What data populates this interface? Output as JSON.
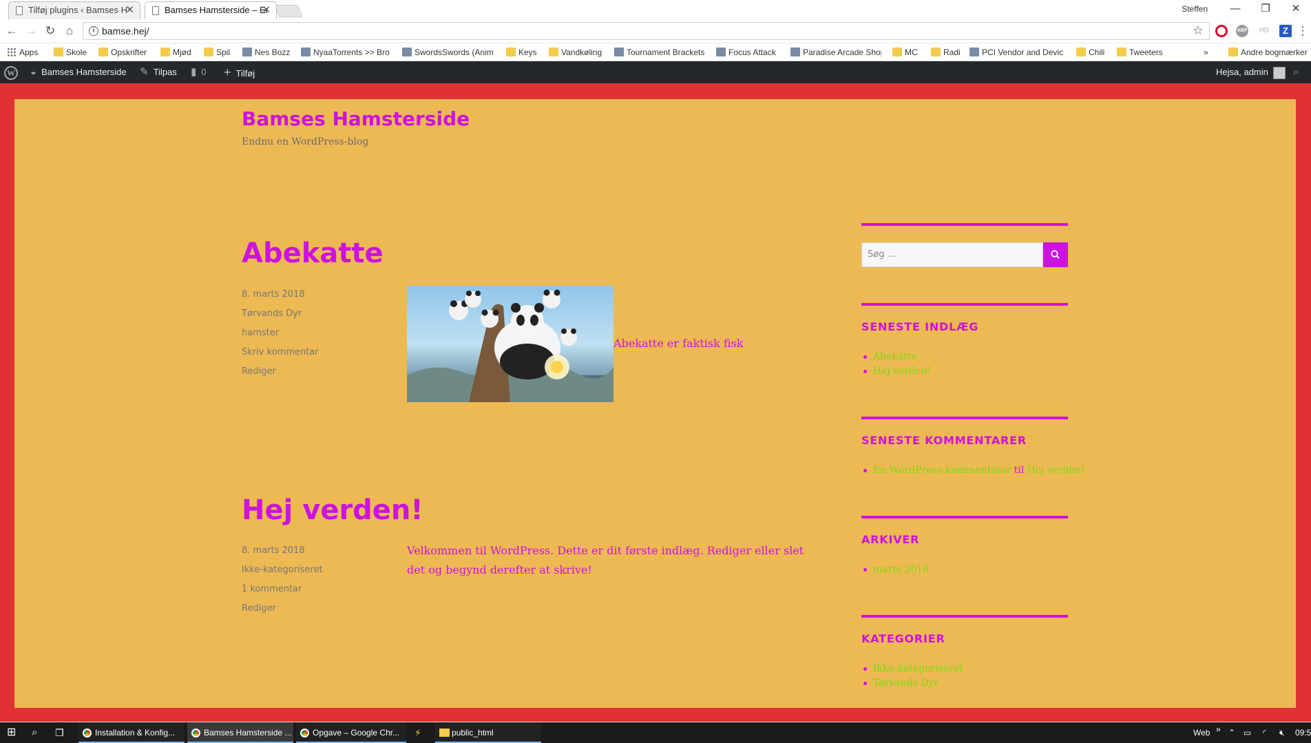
{
  "browser": {
    "tabs": [
      {
        "title": "Tilføj plugins ‹ Bamses H"
      },
      {
        "title": "Bamses Hamsterside – En"
      }
    ],
    "profile_name": "Steffen",
    "url": "bamse.hej/",
    "ext_abp": "ABP",
    "ext_hd": "HD",
    "ext_z": "Z",
    "bookmarks": [
      "Apps",
      "Skole",
      "Opskrifter",
      "Mjød",
      "Spil",
      "Nes Bozz",
      "NyaaTorrents >> Bro",
      "SwordsSwords (Anim",
      "Keys",
      "Vandkøling",
      "Tournament Brackets",
      "Focus Attack",
      "Paradise Arcade Shop",
      "MC",
      "Radi",
      "PCI Vendor and Devic",
      "Chili",
      "Tweeters"
    ],
    "bookmarks_more": "»",
    "other_bookmarks": "Andre bogmærker"
  },
  "adminbar": {
    "site": "Bamses Hamsterside",
    "customize": "Tilpas",
    "comments_count": "0",
    "add_new": "Tilføj",
    "greeting": "Hejsa, admin"
  },
  "site": {
    "title": "Bamses Hamsterside",
    "description": "Endnu en WordPress-blog"
  },
  "posts": [
    {
      "title": "Abekatte",
      "date": "8. marts 2018",
      "category": "Tørvands Dyr",
      "tag": "hamster",
      "comment_link": "Skriv kommentar",
      "edit": "Rediger",
      "content_link": "Abekatte er faktisk fisk"
    },
    {
      "title": "Hej verden!",
      "date": "8. marts 2018",
      "category": "Ikke-kategoriseret",
      "comment_link": "1 kommentar",
      "edit": "Rediger",
      "content": "Velkommen til WordPress. Dette er dit første indlæg. Rediger eller slet det og begynd derefter at skrive!"
    }
  ],
  "sidebar": {
    "search_placeholder": "Søg ...",
    "recent_posts": {
      "title": "SENESTE INDLÆG",
      "items": [
        "Abekatte",
        "Hej verden!"
      ]
    },
    "recent_comments": {
      "title": "SENESTE KOMMENTARER",
      "author": "En WordPress-kommentator",
      "joiner": "til",
      "post": "Hej verden!"
    },
    "archives": {
      "title": "ARKIVER",
      "items": [
        "marts 2018"
      ]
    },
    "categories": {
      "title": "KATEGORIER",
      "items": [
        "Ikke-kategoriseret",
        "Tørvands Dyr"
      ]
    }
  },
  "taskbar": {
    "apps": [
      "Installation & Konfig...",
      "Bamses Hamsterside ...",
      "Opgave – Google Chr...",
      "public_html"
    ],
    "web_label": "Web",
    "clock": "09:5"
  },
  "colors": {
    "accent": "#cc12df",
    "link": "#7adc10",
    "page_bg": "#edb953",
    "frame": "#e03232"
  }
}
